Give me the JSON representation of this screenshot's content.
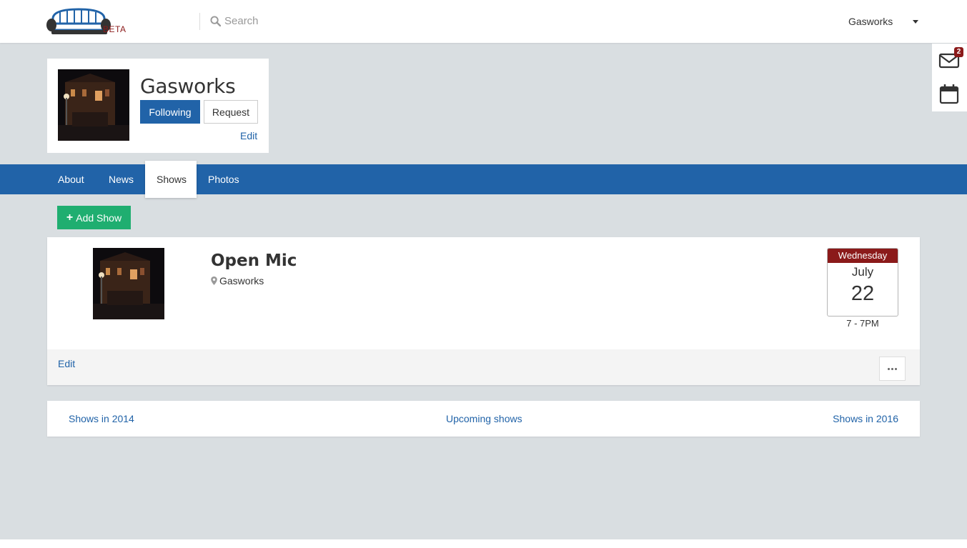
{
  "header": {
    "beta_label": "BETA",
    "search_placeholder": "Search",
    "user_name": "Gasworks"
  },
  "side_panel": {
    "message_count": "2"
  },
  "profile": {
    "name": "Gasworks",
    "following_label": "Following",
    "request_label": "Request",
    "edit_label": "Edit"
  },
  "tabs": [
    {
      "label": "About",
      "active": false
    },
    {
      "label": "News",
      "active": false
    },
    {
      "label": "Shows",
      "active": true
    },
    {
      "label": "Photos",
      "active": false
    }
  ],
  "add_show_label": "Add Show",
  "show": {
    "title": "Open Mic",
    "venue": "Gasworks",
    "weekday": "Wednesday",
    "month": "July",
    "day": "22",
    "time": "7 - 7PM",
    "edit_label": "Edit"
  },
  "pager": {
    "prev_label": "Shows in 2014",
    "current_label": "Upcoming shows",
    "next_label": "Shows in 2016"
  },
  "colors": {
    "brand_blue": "#2163a8",
    "accent_red": "#8b1a1a",
    "add_green": "#1fae70",
    "page_bg": "#d9dee1"
  },
  "icons": [
    "couch-logo-icon",
    "search-icon",
    "caret-down-icon",
    "envelope-icon",
    "calendar-icon",
    "plus-icon",
    "map-marker-icon",
    "ellipsis-icon"
  ]
}
